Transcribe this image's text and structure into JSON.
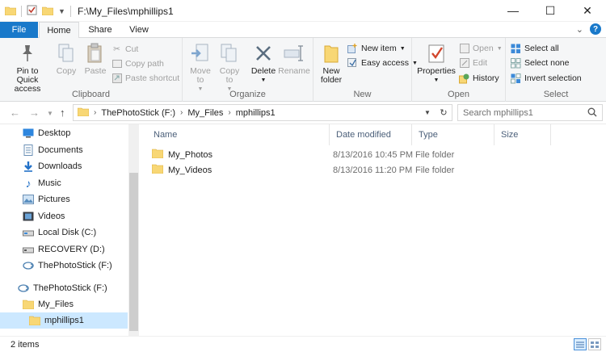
{
  "window": {
    "title": "F:\\My_Files\\mphillips1",
    "minimize": "—",
    "maximize": "☐",
    "close": "✕"
  },
  "tabs": [
    "File",
    "Home",
    "Share",
    "View"
  ],
  "ribbon": {
    "clipboard": {
      "label": "Clipboard",
      "pin": "Pin to Quick access",
      "copy": "Copy",
      "paste": "Paste",
      "cut": "Cut",
      "copy_path": "Copy path",
      "paste_shortcut": "Paste shortcut"
    },
    "organize": {
      "label": "Organize",
      "move_to": "Move to",
      "copy_to": "Copy to",
      "delete": "Delete",
      "rename": "Rename"
    },
    "new": {
      "label": "New",
      "new_folder": "New folder",
      "new_item": "New item",
      "easy_access": "Easy access"
    },
    "open": {
      "label": "Open",
      "properties": "Properties",
      "open": "Open",
      "edit": "Edit",
      "history": "History"
    },
    "select": {
      "label": "Select",
      "select_all": "Select all",
      "select_none": "Select none",
      "invert_selection": "Invert selection"
    }
  },
  "address": {
    "crumbs": [
      "ThePhotoStick (F:)",
      "My_Files",
      "mphillips1"
    ],
    "search_placeholder": "Search mphillips1"
  },
  "nav_pane": {
    "items": [
      {
        "label": "Desktop",
        "icon": "desktop-icon"
      },
      {
        "label": "Documents",
        "icon": "documents-icon"
      },
      {
        "label": "Downloads",
        "icon": "downloads-icon"
      },
      {
        "label": "Music",
        "icon": "music-icon"
      },
      {
        "label": "Pictures",
        "icon": "pictures-icon"
      },
      {
        "label": "Videos",
        "icon": "videos-icon"
      },
      {
        "label": "Local Disk (C:)",
        "icon": "disk-icon"
      },
      {
        "label": "RECOVERY (D:)",
        "icon": "disk-icon"
      },
      {
        "label": "ThePhotoStick (F:)",
        "icon": "usb-drive-icon"
      },
      {
        "label": "ThePhotoStick (F:)",
        "icon": "usb-drive-icon"
      },
      {
        "label": "My_Files",
        "icon": "folder-icon"
      },
      {
        "label": "mphillips1",
        "icon": "folder-icon",
        "selected": true
      }
    ]
  },
  "columns": [
    "Name",
    "Date modified",
    "Type",
    "Size"
  ],
  "files": [
    {
      "name": "My_Photos",
      "date": "8/13/2016 10:45 PM",
      "type": "File folder",
      "size": ""
    },
    {
      "name": "My_Videos",
      "date": "8/13/2016 11:20 PM",
      "type": "File folder",
      "size": ""
    }
  ],
  "status": {
    "count": "2 items"
  },
  "colors": {
    "accent": "#1979ca",
    "folder": "#f8d775",
    "selected": "#cce8ff"
  }
}
